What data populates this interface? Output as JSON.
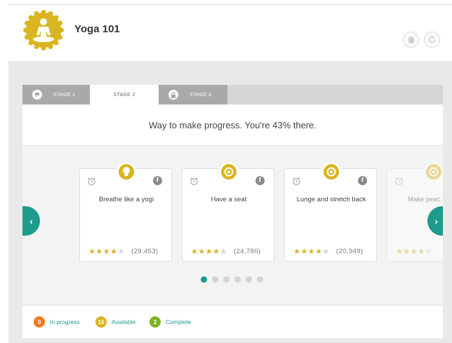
{
  "app": {
    "title": "Yoga 101"
  },
  "colors": {
    "gold": "#d9b521",
    "teal": "#1d9c8c",
    "orange": "#f07a23",
    "green": "#7fb224",
    "tab_inactive": "#a9a9a9"
  },
  "header": {
    "buttons": [
      {
        "icon": "hand-icon"
      },
      {
        "icon": "refresh-icon"
      }
    ]
  },
  "tabs": [
    {
      "label": "STAGE 1",
      "state": "inactive",
      "icon": "flag-icon"
    },
    {
      "label": "STAGE 2",
      "state": "active"
    },
    {
      "label": "STAGE 3",
      "state": "inactive",
      "icon": "lock-icon"
    }
  ],
  "progress_message": "Way to make progress. You're 43% there.",
  "progress_percent": 43,
  "cards": [
    {
      "title": "Breathe like a yogi",
      "rating": 4,
      "count": "(29,453)",
      "badge_icon": "lightbulb-icon"
    },
    {
      "title": "Have a seat",
      "rating": 4,
      "count": "(24,780)",
      "badge_icon": "target-icon"
    },
    {
      "title": "Lunge and stretch back",
      "rating": 4,
      "count": "(20,949)",
      "badge_icon": "target-icon"
    },
    {
      "title": "Make peac... wi...",
      "rating": 4,
      "count": "",
      "badge_icon": "target-icon"
    }
  ],
  "pagination": {
    "pages": 6,
    "current": 1
  },
  "legend": [
    {
      "count": "0",
      "label": "In progress",
      "color": "#f07a23"
    },
    {
      "count": "16",
      "label": "Available",
      "color": "#d9b521"
    },
    {
      "count": "2",
      "label": "Complete",
      "color": "#7fb224"
    }
  ]
}
